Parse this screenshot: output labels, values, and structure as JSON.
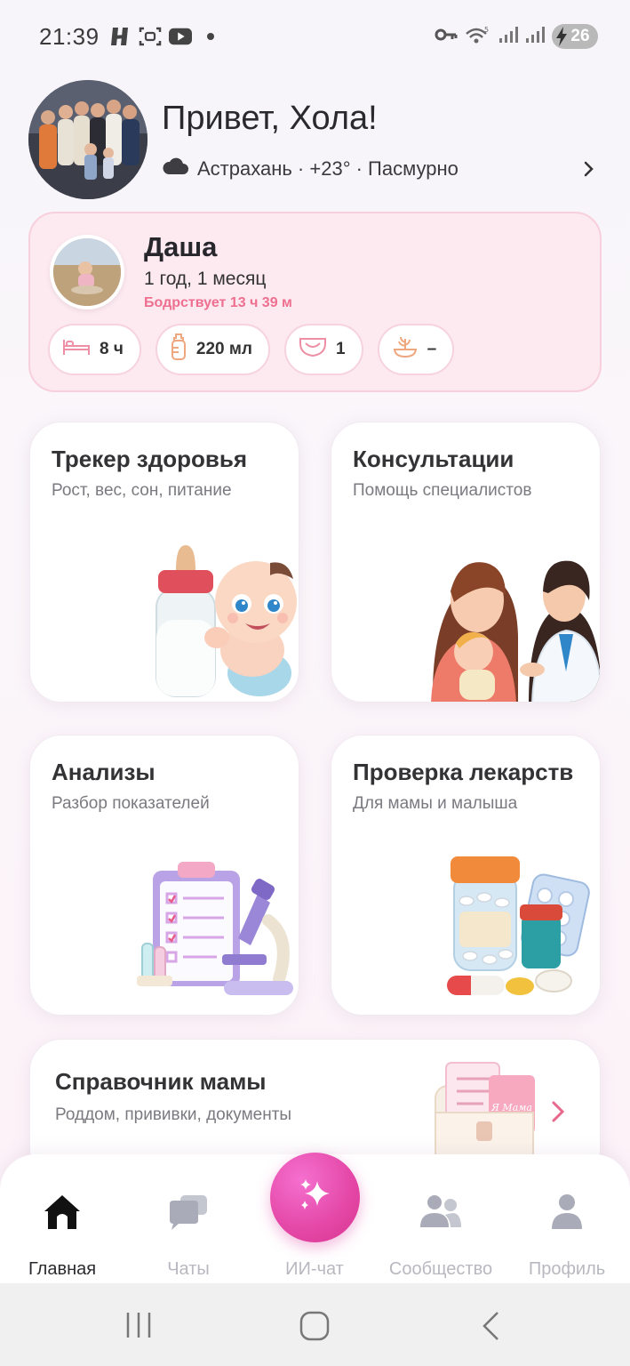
{
  "status_bar": {
    "time": "21:39",
    "battery": "26"
  },
  "header": {
    "greeting": "Привет, Хола!",
    "weather": "Астрахань · +23° · Пасмурно"
  },
  "baby": {
    "name": "Даша",
    "age": "1 год, 1 месяц",
    "awake": "Бодрствует 13 ч 39 м",
    "stats": {
      "sleep": "8 ч",
      "milk": "220 мл",
      "diapers": "1",
      "food": "–"
    }
  },
  "cards": {
    "health": {
      "title": "Трекер здоровья",
      "subtitle": "Рост, вес, сон, питание"
    },
    "consult": {
      "title": "Консультации",
      "subtitle": "Помощь специалистов"
    },
    "tests": {
      "title": "Анализы",
      "subtitle": "Разбор показателей"
    },
    "meds": {
      "title": "Проверка лекарств",
      "subtitle": "Для мамы и малыша"
    },
    "guide": {
      "title": "Справочник мамы",
      "subtitle": "Роддом, прививки, документы",
      "badge": "Я Мама"
    }
  },
  "nav": {
    "home": "Главная",
    "chats": "Чаты",
    "ai": "ИИ-чат",
    "community": "Сообщество",
    "profile": "Профиль"
  },
  "colors": {
    "accent": "#e54aa9",
    "awake_text": "#ee6f8f",
    "baby_card_bg": "#fde9f0"
  }
}
